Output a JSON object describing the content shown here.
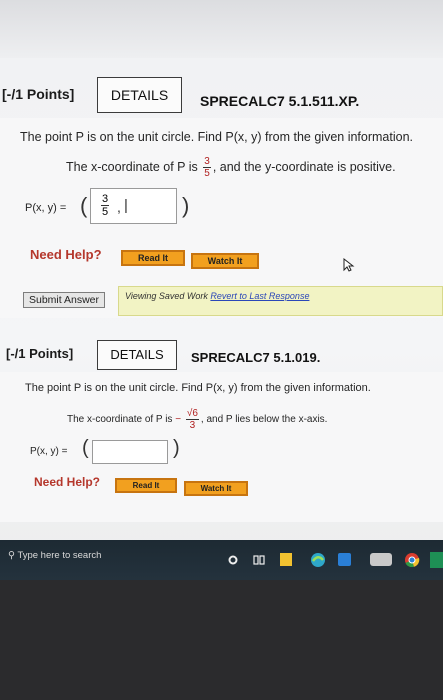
{
  "question1": {
    "points": "[-/1 Points]",
    "details_label": "DETAILS",
    "code": "SPRECALC7 5.1.511.XP.",
    "prompt": "The point P is on the unit circle. Find P(x, y) from the given information.",
    "x_coordinate_prefix": "The x-coordinate of P is",
    "x_numerator": "3",
    "x_denominator": "5",
    "x_suffix": ", and the y-coordinate is positive.",
    "answer_label": "P(x, y) =",
    "answer_open_paren": "(",
    "answer_close_paren": ")",
    "answer_num": "3",
    "answer_den": "5",
    "answer_comma": ",",
    "answer_cursor": "|",
    "need_help": "Need Help?",
    "read_it": "Read It",
    "watch_it": "Watch It",
    "submit": "Submit Answer",
    "saved_text": "Viewing Saved Work",
    "revert_link": "Revert to Last Response"
  },
  "question2": {
    "points": "[-/1 Points]",
    "details_label": "DETAILS",
    "code": "SPRECALC7 5.1.019.",
    "prompt": "The point P is on the unit circle. Find P(x, y) from the given information.",
    "x_coordinate_prefix": "The x-coordinate of P is",
    "x_sign": "−",
    "x_numerator": "√6",
    "x_denominator": "3",
    "x_suffix": ", and P lies below the x-axis.",
    "answer_label": "P(x, y) =",
    "answer_open_paren": "(",
    "answer_close_paren": ")",
    "need_help": "Need Help?",
    "read_it": "Read It",
    "watch_it": "Watch It"
  },
  "taskbar": {
    "search_placeholder": "Type here to search"
  },
  "colors": {
    "need_help": "#b5372c",
    "help_button": "#f2a01f",
    "saved_bar": "#f2f3c4",
    "taskbar": "#1d2a33"
  }
}
